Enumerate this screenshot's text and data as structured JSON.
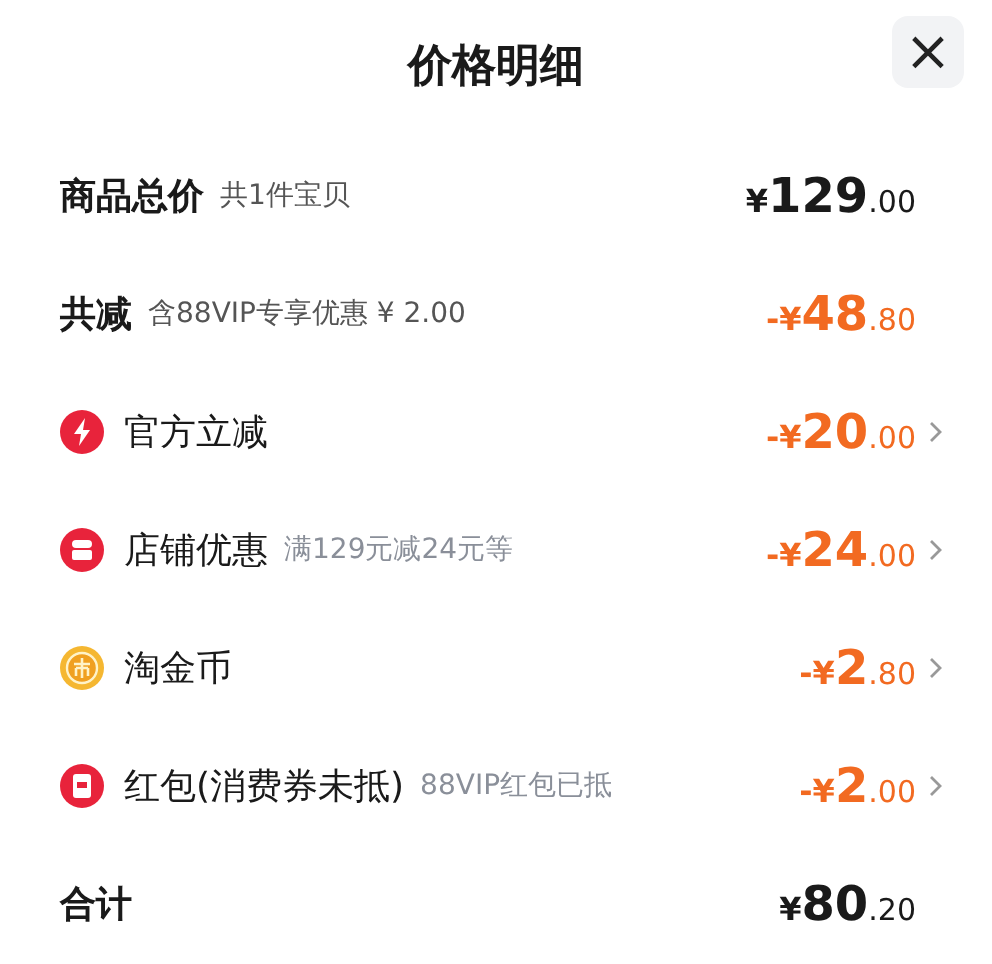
{
  "header": {
    "title": "价格明细",
    "close": "×"
  },
  "rows": [
    {
      "kind": "subtotal",
      "label": "商品总价",
      "note": "共1件宝贝",
      "sign": "¥",
      "integer": "129",
      "decimal": ".00"
    },
    {
      "kind": "reduction",
      "label": "共减",
      "note": "含88VIP专享优惠 ¥ 2.00",
      "sign": "-¥",
      "integer": "48",
      "decimal": ".80"
    },
    {
      "kind": "item",
      "label": "官方立减",
      "sign": "-¥",
      "integer": "20",
      "decimal": ".00"
    },
    {
      "kind": "item",
      "label": "店铺优惠",
      "note": "满129元减24元等",
      "sign": "-¥",
      "integer": "24",
      "decimal": ".00"
    },
    {
      "kind": "item",
      "label": "淘金币",
      "sign": "-¥",
      "integer": "2",
      "decimal": ".80"
    },
    {
      "kind": "item",
      "label": "红包(消费券未抵)",
      "note": "88VIP红包已抵",
      "sign": "-¥",
      "integer": "2",
      "decimal": ".00"
    },
    {
      "kind": "total",
      "label": "合计",
      "sign": "¥",
      "integer": "80",
      "decimal": ".20"
    }
  ]
}
